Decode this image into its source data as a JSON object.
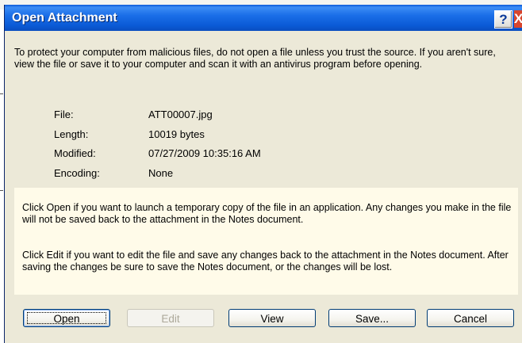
{
  "dialog": {
    "title": "Open Attachment",
    "help_label": "?",
    "close_label": "X",
    "intro": "To protect your computer from malicious files, do not open a file unless you trust the source. If you aren't sure, view the file or save it to your computer and scan it with an antivirus program before opening.",
    "fields": [
      {
        "label": "File:",
        "value": "ATT00007.jpg"
      },
      {
        "label": "Length:",
        "value": "10019 bytes"
      },
      {
        "label": "Modified:",
        "value": "07/27/2009 10:35:16 AM"
      },
      {
        "label": "Encoding:",
        "value": "None"
      }
    ],
    "info_open": "Click Open if you want to launch a temporary copy of the file in an application. Any changes you make in the file will not be saved back to the attachment in the Notes document.",
    "info_edit": "Click Edit if you want to edit the file and save any changes back to the attachment in the Notes document. After saving the changes be sure to save the Notes document, or the changes will be lost.",
    "buttons": {
      "open": "Open",
      "edit": "Edit",
      "view": "View",
      "save": "Save...",
      "cancel": "Cancel"
    }
  }
}
